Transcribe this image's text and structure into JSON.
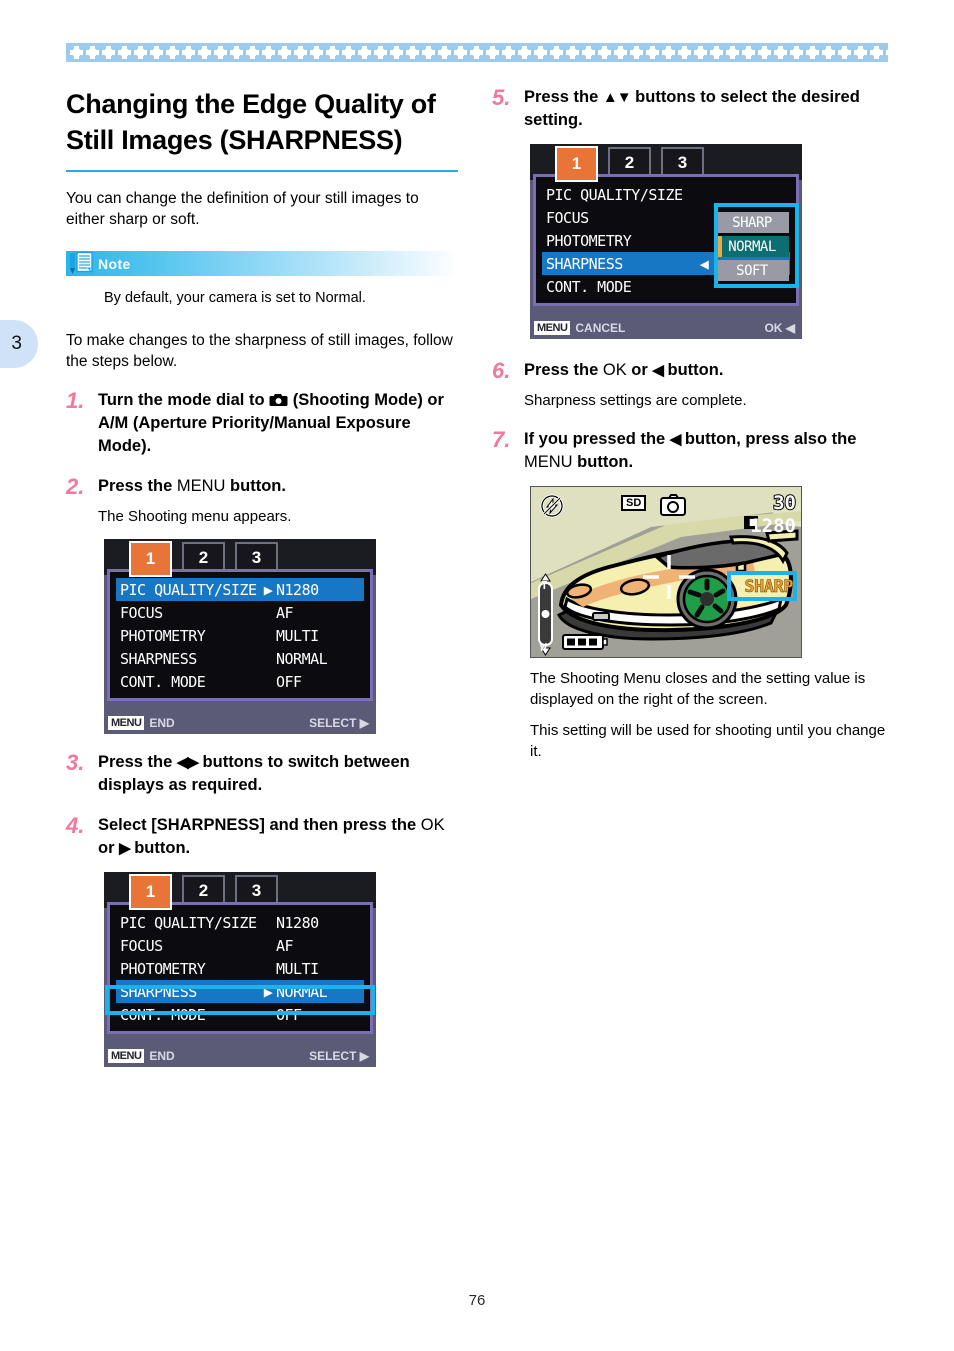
{
  "page": {
    "number": "76",
    "chapter_tab": "3"
  },
  "heading": {
    "title": "Changing the Edge Quality of Still Images (SHARPNESS)",
    "intro": "You can change the definition of your still images to either sharp or soft."
  },
  "note": {
    "label": "Note",
    "icon": "note-pencil-icon",
    "body": "By default, your camera is set to Normal."
  },
  "lead_in": "To make changes to the sharpness of still images, follow the steps below.",
  "steps": [
    {
      "num": "1.",
      "text_before": "Turn the mode dial to ",
      "icon": "camera-icon",
      "text_after": " (Shooting Mode) or A/M (Aperture Priority/Manual Exposure Mode)."
    },
    {
      "num": "2.",
      "text_before": "Press the ",
      "key": "MENU",
      "text_after": " button.",
      "sub": "The Shooting menu appears."
    },
    {
      "num": "3.",
      "text_before": "Press the ",
      "icon": "left-right-triangle-icon",
      "text_after": " buttons to switch between displays as required."
    },
    {
      "num": "4.",
      "text_before": "Select  [SHARPNESS] and then press the ",
      "key": "OK",
      "mid": " or ",
      "icon": "right-triangle-icon",
      "text_after": " button."
    },
    {
      "num": "5.",
      "text_before": "Press  the ",
      "icon": "up-down-triangle-icon",
      "text_after": " buttons to select the desired setting."
    },
    {
      "num": "6.",
      "text_before": "Press the ",
      "key": "OK",
      "mid": " or ",
      "icon": "left-triangle-icon",
      "text_after": " button.",
      "sub": "Sharpness settings are complete."
    },
    {
      "num": "7.",
      "text_before": "If you pressed the ",
      "icon": "left-triangle-icon",
      "text_after": " button, press also the ",
      "key": "MENU",
      "text_end": " button."
    }
  ],
  "closing": {
    "para1": "The Shooting Menu closes and the setting value is displayed on the right of the screen.",
    "para2": "This setting will be used for shooting until you change it."
  },
  "screens": {
    "menu_step2": {
      "tabs": [
        "1",
        "2",
        "3"
      ],
      "active_tab": "1",
      "rows": [
        {
          "label": "PIC QUALITY/SIZE",
          "value": "N1280",
          "selected": true,
          "arrow": "▶"
        },
        {
          "label": "FOCUS",
          "value": "AF",
          "selected": false,
          "arrow": ""
        },
        {
          "label": "PHOTOMETRY",
          "value": "MULTI",
          "selected": false,
          "arrow": ""
        },
        {
          "label": "SHARPNESS",
          "value": "NORMAL",
          "selected": false,
          "arrow": ""
        },
        {
          "label": "CONT. MODE",
          "value": "OFF",
          "selected": false,
          "arrow": ""
        }
      ],
      "footer_key": "MENU",
      "footer_left": "END",
      "footer_right": "SELECT ▶"
    },
    "menu_step4": {
      "tabs": [
        "1",
        "2",
        "3"
      ],
      "active_tab": "1",
      "rows": [
        {
          "label": "PIC QUALITY/SIZE",
          "value": "N1280",
          "selected": false,
          "arrow": ""
        },
        {
          "label": "FOCUS",
          "value": "AF",
          "selected": false,
          "arrow": ""
        },
        {
          "label": "PHOTOMETRY",
          "value": "MULTI",
          "selected": false,
          "arrow": ""
        },
        {
          "label": "SHARPNESS",
          "value": "NORMAL",
          "selected": true,
          "arrow": "▶"
        },
        {
          "label": "CONT. MODE",
          "value": "OFF",
          "selected": false,
          "arrow": ""
        }
      ],
      "footer_key": "MENU",
      "footer_left": "END",
      "footer_right": "SELECT ▶",
      "highlight": "sharpness-row"
    },
    "menu_step5": {
      "tabs": [
        "1",
        "2",
        "3"
      ],
      "active_tab": "1",
      "rows": [
        {
          "label": "PIC QUALITY/SIZE",
          "value": "",
          "selected": false,
          "arrow": ""
        },
        {
          "label": "FOCUS",
          "value": "",
          "selected": false,
          "arrow": ""
        },
        {
          "label": "PHOTOMETRY",
          "value": "",
          "selected": false,
          "arrow": ""
        },
        {
          "label": "SHARPNESS",
          "value": "",
          "selected": true,
          "arrow": "◀"
        },
        {
          "label": "CONT. MODE",
          "value": "",
          "selected": false,
          "arrow": ""
        }
      ],
      "options": [
        {
          "label": "SHARP",
          "current": false
        },
        {
          "label": "NORMAL",
          "current": true
        },
        {
          "label": "SOFT",
          "current": false
        }
      ],
      "footer_key": "MENU",
      "footer_left": "CANCEL",
      "footer_right": "OK ◀",
      "highlight": "options-panel"
    },
    "photo_step7": {
      "osd": {
        "flash_icon": "flash-off-icon",
        "card_icon": "SD",
        "mode_icon": "camera-icon",
        "remaining_shots": "30",
        "image_size": "1280",
        "quality_icon": "quality-icon",
        "zoom_top": "T",
        "zoom_bottom": "W",
        "battery_icon": "battery-full-icon",
        "setting_value": "SHARP"
      },
      "subject": "yellow-race-car",
      "highlight": "sharp-tag"
    }
  },
  "colors": {
    "accent_blue": "#29abe2",
    "step_number": "#f2799b",
    "annotation_cyan": "#18b4ea",
    "tab_orange": "#e87437",
    "lcd_select_blue": "#1877c4",
    "chapter_tab_bg": "#cfe2f7"
  }
}
